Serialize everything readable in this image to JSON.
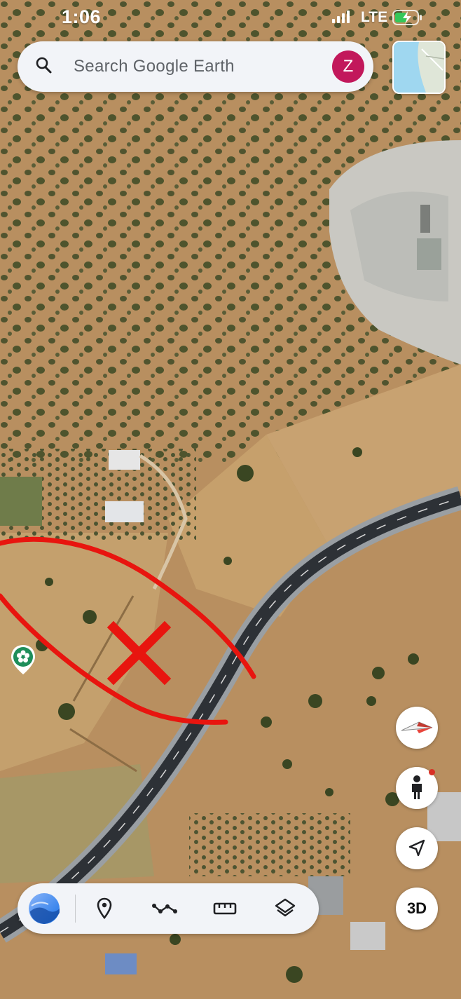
{
  "status_bar": {
    "time": "1:06",
    "network": "LTE"
  },
  "search": {
    "placeholder": "Search Google Earth",
    "avatar_letter": "Z"
  },
  "minimap": {
    "icon": "minimap-thumbnail"
  },
  "map": {
    "annotation": "red-hand-drawn-outline-with-x-mark",
    "annotation_color": "#e8150f",
    "marker": "green-place-pin"
  },
  "controls": {
    "compass": "compass-icon",
    "street_view": "pegman-icon",
    "my_location": "navigation-arrow-icon",
    "three_d_label": "3D"
  },
  "toolbar": {
    "items": [
      "earth-logo-icon",
      "place-marker-icon",
      "path-icon",
      "ruler-icon",
      "layers-icon"
    ]
  },
  "colors": {
    "accent": "#c2185b",
    "pin": "#1e8e5a",
    "battery": "#35c759"
  }
}
